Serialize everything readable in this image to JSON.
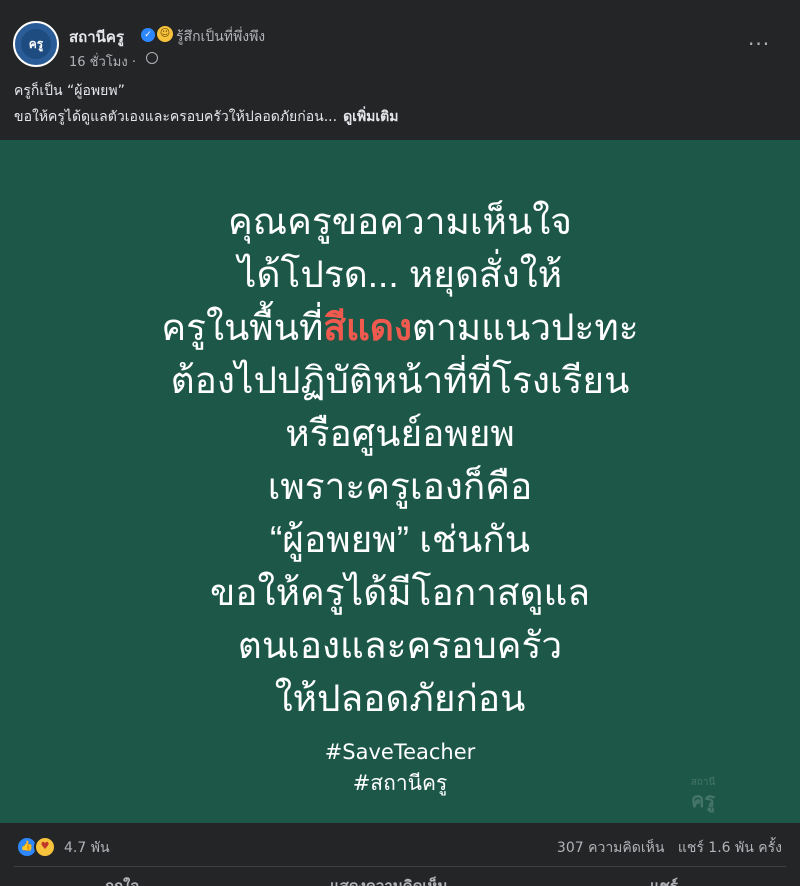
{
  "post": {
    "page_name": "สถานีครู",
    "feeling": "รู้สึกเป็นที่พึ่งพึง",
    "time": "16 ชั่วโมง ·",
    "avatar_text": "ครู",
    "more_label": "···",
    "caption_line1": "ครูก็เป็น “ผู้อพยพ”",
    "caption_line2": "ขอให้ครูได้ดูแลตัวเองและครอบครัวให้ปลอดภัยก่อน...",
    "see_more": "ดูเพิ่มเติม"
  },
  "image": {
    "background": "#1c5747",
    "lines": [
      "คุณครูขอความเห็นใจ",
      "ได้โปรด... หยุดสั่งให้",
      "ตามแนวปะทะ",
      "ต้องไปปฏิบัติหน้าที่ที่โรงเรียน",
      "หรือศูนย์อพยพ",
      "เพราะครูเองก็คือ",
      "“ผู้อพยพ” เช่นกัน",
      "ขอให้ครูได้มีโอกาสดูแล",
      "ตนเองและครอบครัว",
      "ให้ปลอดภัยก่อน"
    ],
    "line3_prefix": "ครูในพื้นที่",
    "line3_highlight": "สีแดง",
    "highlight_color": "#f05a4e",
    "hashtag1": "#SaveTeacher",
    "hashtag2": "#สถานีครู",
    "watermark_small": "สถานี",
    "watermark_big": "ครู"
  },
  "footer": {
    "reaction_count": "4.7 พัน",
    "comments": "307 ความคิดเห็น",
    "shares": "แชร์ 1.6 พัน ครั้ง",
    "actions": [
      "ถูกใจ",
      "แสดงความคิดเห็น",
      "แชร์"
    ]
  }
}
